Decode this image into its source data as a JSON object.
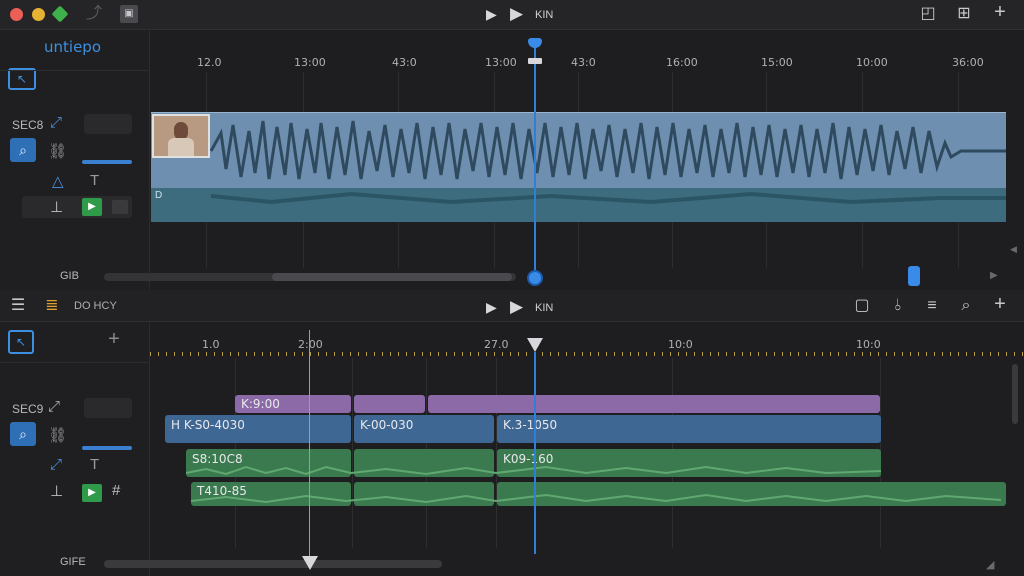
{
  "titlebar": {
    "transport_label": "KIN",
    "icons": [
      "undo-icon",
      "save-icon",
      "play-icon",
      "play-icon",
      "clock-icon",
      "grid-icon",
      "plus-icon"
    ]
  },
  "top": {
    "logo_text": "untiepo",
    "ruler": [
      "12.0",
      "13:00",
      "43:0",
      "13:00",
      "43:0",
      "16:00",
      "15:00",
      "10:00",
      "36:00"
    ],
    "side": {
      "label_1": "SEC8",
      "footer": "GIB"
    }
  },
  "bottom": {
    "header_label": "DO HCY",
    "transport_label": "KIN",
    "ruler": [
      "1.0",
      "2:00",
      "27.0",
      "10:0",
      "10:0"
    ],
    "side": {
      "label_1": "SEC9",
      "footer": "GIFE"
    },
    "clips": {
      "purple": [
        "K:9:00",
        "",
        ""
      ],
      "blue": [
        "H K-S0-4030",
        "K-00-030",
        "K.3-1050"
      ],
      "green_1": [
        "S8:10C8",
        "",
        "K09-160"
      ],
      "green_2": [
        "T410-85",
        "",
        ""
      ]
    }
  },
  "colors": {
    "accent": "#3d8fe0",
    "playhead": "#2f7fd8",
    "green": "#2f9a4a",
    "orange_marker": "#e08a50"
  }
}
